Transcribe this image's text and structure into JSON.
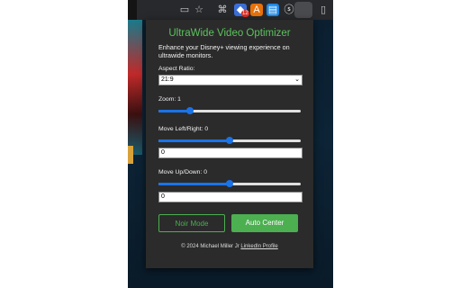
{
  "colors": {
    "accent": "#4caf50",
    "title": "#5cc25e",
    "slider": "#1a73e8",
    "panel": "#2b2b2b"
  },
  "toolbar": {
    "icons": [
      "tab-icon",
      "star-icon",
      "extension-a-icon",
      "extension-badge-icon",
      "extension-b-icon",
      "extension-c-icon",
      "extension-d-icon",
      "extension-active-icon",
      "puzzle-icon"
    ],
    "badge_count": "12"
  },
  "popup": {
    "title": "UltraWide Video Optimizer",
    "intro": "Enhance your Disney+ viewing experience on ultrawide monitors.",
    "aspect": {
      "label": "Aspect Ratio:",
      "value": "21:9"
    },
    "zoom": {
      "label_prefix": "Zoom:",
      "value": "1",
      "fraction": 0.22
    },
    "move_lr": {
      "label_prefix": "Move Left/Right:",
      "value": "0",
      "fraction": 0.5,
      "input_value": "0"
    },
    "move_ud": {
      "label_prefix": "Move Up/Down:",
      "value": "0",
      "fraction": 0.5,
      "input_value": "0"
    },
    "noir_label": "Noir Mode",
    "auto_label": "Auto Center",
    "footer_text": "© 2024 Michael Miller Jr",
    "footer_link": "LinkedIn Profile"
  }
}
